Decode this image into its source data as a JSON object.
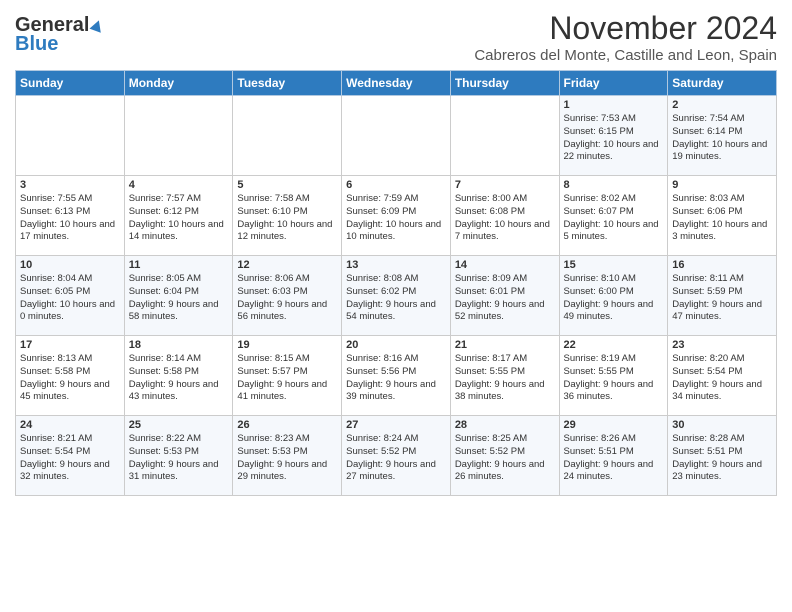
{
  "header": {
    "logo_general": "General",
    "logo_blue": "Blue",
    "month_title": "November 2024",
    "subtitle": "Cabreros del Monte, Castille and Leon, Spain"
  },
  "weekdays": [
    "Sunday",
    "Monday",
    "Tuesday",
    "Wednesday",
    "Thursday",
    "Friday",
    "Saturday"
  ],
  "weeks": [
    [
      {
        "day": "",
        "info": ""
      },
      {
        "day": "",
        "info": ""
      },
      {
        "day": "",
        "info": ""
      },
      {
        "day": "",
        "info": ""
      },
      {
        "day": "",
        "info": ""
      },
      {
        "day": "1",
        "info": "Sunrise: 7:53 AM\nSunset: 6:15 PM\nDaylight: 10 hours and 22 minutes."
      },
      {
        "day": "2",
        "info": "Sunrise: 7:54 AM\nSunset: 6:14 PM\nDaylight: 10 hours and 19 minutes."
      }
    ],
    [
      {
        "day": "3",
        "info": "Sunrise: 7:55 AM\nSunset: 6:13 PM\nDaylight: 10 hours and 17 minutes."
      },
      {
        "day": "4",
        "info": "Sunrise: 7:57 AM\nSunset: 6:12 PM\nDaylight: 10 hours and 14 minutes."
      },
      {
        "day": "5",
        "info": "Sunrise: 7:58 AM\nSunset: 6:10 PM\nDaylight: 10 hours and 12 minutes."
      },
      {
        "day": "6",
        "info": "Sunrise: 7:59 AM\nSunset: 6:09 PM\nDaylight: 10 hours and 10 minutes."
      },
      {
        "day": "7",
        "info": "Sunrise: 8:00 AM\nSunset: 6:08 PM\nDaylight: 10 hours and 7 minutes."
      },
      {
        "day": "8",
        "info": "Sunrise: 8:02 AM\nSunset: 6:07 PM\nDaylight: 10 hours and 5 minutes."
      },
      {
        "day": "9",
        "info": "Sunrise: 8:03 AM\nSunset: 6:06 PM\nDaylight: 10 hours and 3 minutes."
      }
    ],
    [
      {
        "day": "10",
        "info": "Sunrise: 8:04 AM\nSunset: 6:05 PM\nDaylight: 10 hours and 0 minutes."
      },
      {
        "day": "11",
        "info": "Sunrise: 8:05 AM\nSunset: 6:04 PM\nDaylight: 9 hours and 58 minutes."
      },
      {
        "day": "12",
        "info": "Sunrise: 8:06 AM\nSunset: 6:03 PM\nDaylight: 9 hours and 56 minutes."
      },
      {
        "day": "13",
        "info": "Sunrise: 8:08 AM\nSunset: 6:02 PM\nDaylight: 9 hours and 54 minutes."
      },
      {
        "day": "14",
        "info": "Sunrise: 8:09 AM\nSunset: 6:01 PM\nDaylight: 9 hours and 52 minutes."
      },
      {
        "day": "15",
        "info": "Sunrise: 8:10 AM\nSunset: 6:00 PM\nDaylight: 9 hours and 49 minutes."
      },
      {
        "day": "16",
        "info": "Sunrise: 8:11 AM\nSunset: 5:59 PM\nDaylight: 9 hours and 47 minutes."
      }
    ],
    [
      {
        "day": "17",
        "info": "Sunrise: 8:13 AM\nSunset: 5:58 PM\nDaylight: 9 hours and 45 minutes."
      },
      {
        "day": "18",
        "info": "Sunrise: 8:14 AM\nSunset: 5:58 PM\nDaylight: 9 hours and 43 minutes."
      },
      {
        "day": "19",
        "info": "Sunrise: 8:15 AM\nSunset: 5:57 PM\nDaylight: 9 hours and 41 minutes."
      },
      {
        "day": "20",
        "info": "Sunrise: 8:16 AM\nSunset: 5:56 PM\nDaylight: 9 hours and 39 minutes."
      },
      {
        "day": "21",
        "info": "Sunrise: 8:17 AM\nSunset: 5:55 PM\nDaylight: 9 hours and 38 minutes."
      },
      {
        "day": "22",
        "info": "Sunrise: 8:19 AM\nSunset: 5:55 PM\nDaylight: 9 hours and 36 minutes."
      },
      {
        "day": "23",
        "info": "Sunrise: 8:20 AM\nSunset: 5:54 PM\nDaylight: 9 hours and 34 minutes."
      }
    ],
    [
      {
        "day": "24",
        "info": "Sunrise: 8:21 AM\nSunset: 5:54 PM\nDaylight: 9 hours and 32 minutes."
      },
      {
        "day": "25",
        "info": "Sunrise: 8:22 AM\nSunset: 5:53 PM\nDaylight: 9 hours and 31 minutes."
      },
      {
        "day": "26",
        "info": "Sunrise: 8:23 AM\nSunset: 5:53 PM\nDaylight: 9 hours and 29 minutes."
      },
      {
        "day": "27",
        "info": "Sunrise: 8:24 AM\nSunset: 5:52 PM\nDaylight: 9 hours and 27 minutes."
      },
      {
        "day": "28",
        "info": "Sunrise: 8:25 AM\nSunset: 5:52 PM\nDaylight: 9 hours and 26 minutes."
      },
      {
        "day": "29",
        "info": "Sunrise: 8:26 AM\nSunset: 5:51 PM\nDaylight: 9 hours and 24 minutes."
      },
      {
        "day": "30",
        "info": "Sunrise: 8:28 AM\nSunset: 5:51 PM\nDaylight: 9 hours and 23 minutes."
      }
    ]
  ]
}
